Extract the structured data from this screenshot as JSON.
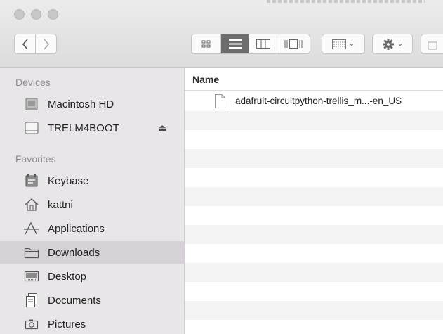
{
  "toolbar": {
    "back_icon": "chevron-left-icon",
    "forward_icon": "chevron-right-icon",
    "view_modes": [
      "icon-view",
      "list-view",
      "column-view",
      "cover-flow-view"
    ],
    "active_view": "list-view",
    "group_menu_icon": "group-by-icon",
    "action_menu_icon": "gear-icon"
  },
  "sidebar": {
    "devices_heading": "Devices",
    "devices": [
      {
        "label": "Macintosh HD",
        "icon": "hard-drive-icon"
      },
      {
        "label": "TRELM4BOOT",
        "icon": "external-drive-icon",
        "eject": "⏏"
      }
    ],
    "favorites_heading": "Favorites",
    "favorites": [
      {
        "label": "Keybase",
        "icon": "keybase-icon"
      },
      {
        "label": "kattni",
        "icon": "home-icon"
      },
      {
        "label": "Applications",
        "icon": "applications-icon"
      },
      {
        "label": "Downloads",
        "icon": "folder-icon",
        "selected": true
      },
      {
        "label": "Desktop",
        "icon": "desktop-icon"
      },
      {
        "label": "Documents",
        "icon": "documents-icon"
      },
      {
        "label": "Pictures",
        "icon": "pictures-icon"
      }
    ]
  },
  "list": {
    "column_name": "Name",
    "files": [
      {
        "name": "adafruit-circuitpython-trellis_m...-en_US",
        "icon": "document-icon"
      }
    ]
  },
  "colors": {
    "sidebar_bg": "#e9e6ea",
    "selected_bg": "#d7d1d8",
    "active_segment": "#6d6d6d"
  }
}
